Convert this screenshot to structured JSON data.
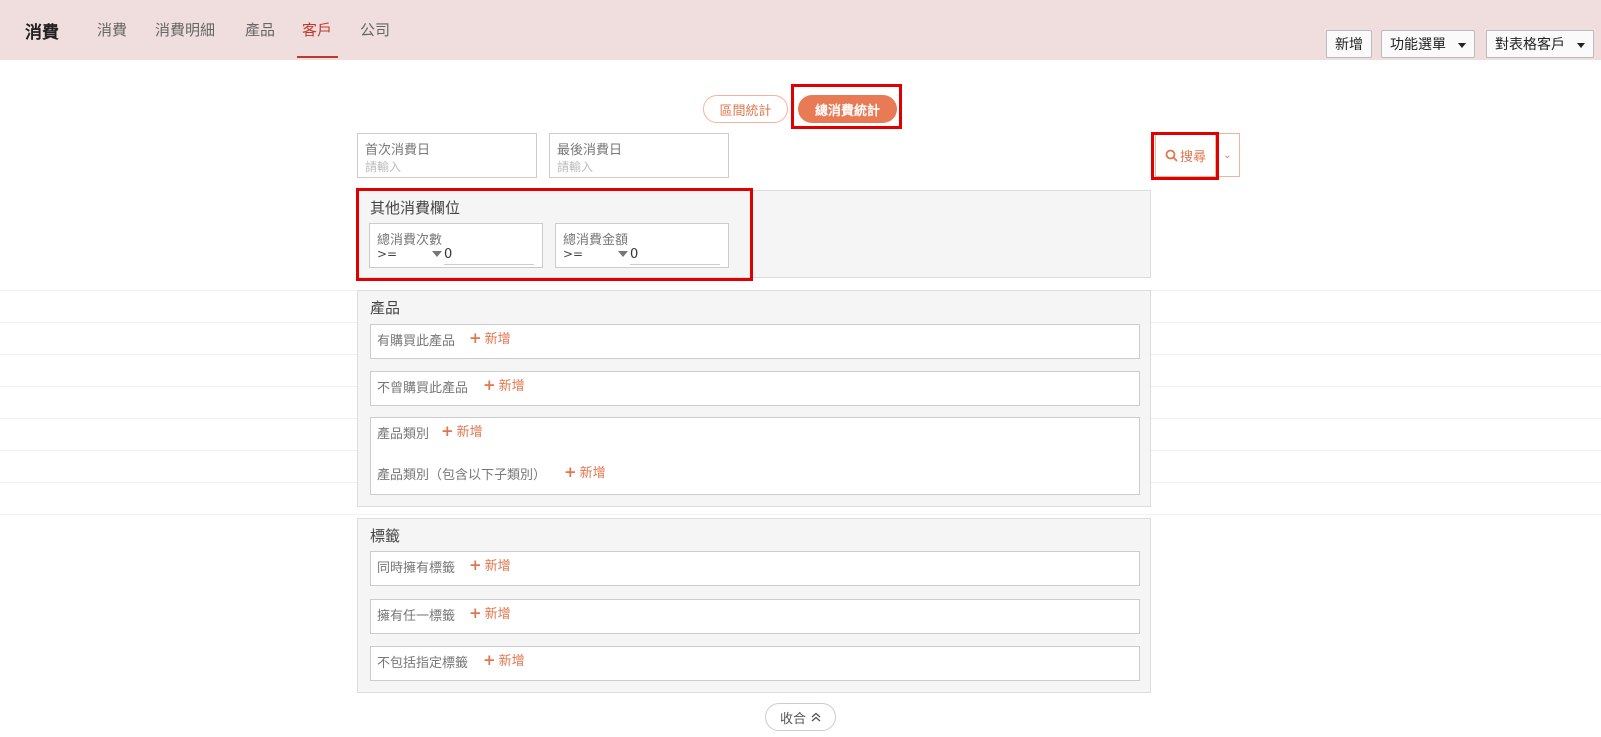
{
  "app": {
    "brand": "消費",
    "nav": [
      "消費",
      "消費明細",
      "產品",
      "客戶",
      "公司"
    ],
    "active_nav": "客戶"
  },
  "toolbar": {
    "add_label": "新增",
    "menu_label": "功能選單",
    "table_label": "對表格客戶"
  },
  "toggle": {
    "range_label": "區間統計",
    "total_label": "總消費統計"
  },
  "dates": {
    "first": {
      "label": "首次消費日",
      "placeholder": "請輸入"
    },
    "last": {
      "label": "最後消費日",
      "placeholder": "請輸入"
    }
  },
  "search": {
    "label": "搜尋"
  },
  "other": {
    "title": "其他消費欄位",
    "count": {
      "label": "總消費次數",
      "op": ">=",
      "value": "0"
    },
    "amount": {
      "label": "總消費金額",
      "op": ">=",
      "value": "0"
    }
  },
  "product": {
    "title": "產品",
    "bought": "有購買此產品",
    "not_bought": "不曾購買此產品",
    "category": "產品類別",
    "category_sub": "產品類別（包含以下子類別）"
  },
  "tags": {
    "title": "標籤",
    "all": "同時擁有標籤",
    "any": "擁有任一標籤",
    "exclude": "不包括指定標籤"
  },
  "add_text": "新增",
  "collapse": {
    "label": "收合"
  },
  "colors": {
    "accent": "#e87a55",
    "nav_active": "#c0392b",
    "highlight": "#e00000"
  }
}
